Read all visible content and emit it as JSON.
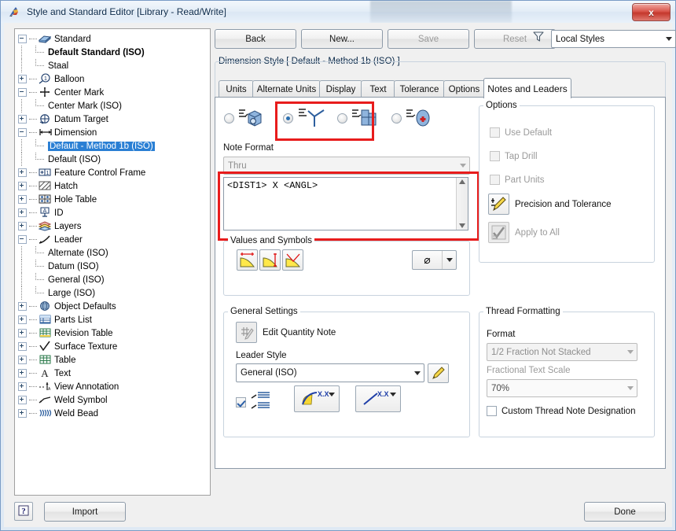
{
  "window": {
    "title": "Style and Standard Editor [Library - Read/Write]",
    "app_icon": "inventor-feather-icon",
    "close_label": "x"
  },
  "colors": {
    "accent": "#2a7fd4",
    "highlight_box": "#e81c1c",
    "title_text": "#0b2a4a",
    "disabled_text": "#9a9a9a"
  },
  "tree": {
    "items": [
      {
        "label": "Standard",
        "level": 0,
        "expander": "minus",
        "icon": "book-icon",
        "style": "normal"
      },
      {
        "label": "Default Standard (ISO)",
        "level": 1,
        "expander": "none",
        "icon": "none",
        "style": "bold"
      },
      {
        "label": "Staal",
        "level": 1,
        "expander": "none",
        "icon": "none",
        "style": "normal"
      },
      {
        "label": "Balloon",
        "level": 0,
        "expander": "plus",
        "icon": "balloon-icon",
        "style": "normal"
      },
      {
        "label": "Center Mark",
        "level": 0,
        "expander": "minus",
        "icon": "center-mark-icon",
        "style": "normal"
      },
      {
        "label": "Center Mark (ISO)",
        "level": 1,
        "expander": "none",
        "icon": "none",
        "style": "normal"
      },
      {
        "label": "Datum Target",
        "level": 0,
        "expander": "plus",
        "icon": "datum-target-icon",
        "style": "normal"
      },
      {
        "label": "Dimension",
        "level": 0,
        "expander": "minus",
        "icon": "dimension-icon",
        "style": "normal"
      },
      {
        "label": "Default - Method 1b (ISO)",
        "level": 1,
        "expander": "none",
        "icon": "none",
        "style": "selected"
      },
      {
        "label": "Default (ISO)",
        "level": 1,
        "expander": "none",
        "icon": "none",
        "style": "normal"
      },
      {
        "label": "Feature Control Frame",
        "level": 0,
        "expander": "plus",
        "icon": "feature-control-frame-icon",
        "style": "normal"
      },
      {
        "label": "Hatch",
        "level": 0,
        "expander": "plus",
        "icon": "hatch-icon",
        "style": "normal"
      },
      {
        "label": "Hole Table",
        "level": 0,
        "expander": "plus",
        "icon": "hole-table-icon",
        "style": "normal"
      },
      {
        "label": "ID",
        "level": 0,
        "expander": "plus",
        "icon": "id-icon",
        "style": "normal"
      },
      {
        "label": "Layers",
        "level": 0,
        "expander": "plus",
        "icon": "layers-icon",
        "style": "normal"
      },
      {
        "label": "Leader",
        "level": 0,
        "expander": "minus",
        "icon": "leader-icon",
        "style": "normal"
      },
      {
        "label": "Alternate (ISO)",
        "level": 1,
        "expander": "none",
        "icon": "none",
        "style": "normal"
      },
      {
        "label": "Datum (ISO)",
        "level": 1,
        "expander": "none",
        "icon": "none",
        "style": "normal"
      },
      {
        "label": "General (ISO)",
        "level": 1,
        "expander": "none",
        "icon": "none",
        "style": "normal"
      },
      {
        "label": "Large (ISO)",
        "level": 1,
        "expander": "none",
        "icon": "none",
        "style": "normal"
      },
      {
        "label": "Object Defaults",
        "level": 0,
        "expander": "plus",
        "icon": "object-defaults-icon",
        "style": "normal"
      },
      {
        "label": "Parts List",
        "level": 0,
        "expander": "plus",
        "icon": "parts-list-icon",
        "style": "normal"
      },
      {
        "label": "Revision Table",
        "level": 0,
        "expander": "plus",
        "icon": "revision-table-icon",
        "style": "normal"
      },
      {
        "label": "Surface Texture",
        "level": 0,
        "expander": "plus",
        "icon": "surface-texture-icon",
        "style": "normal"
      },
      {
        "label": "Table",
        "level": 0,
        "expander": "plus",
        "icon": "table-icon",
        "style": "normal"
      },
      {
        "label": "Text",
        "level": 0,
        "expander": "plus",
        "icon": "text-icon",
        "style": "normal"
      },
      {
        "label": "View Annotation",
        "level": 0,
        "expander": "plus",
        "icon": "view-annotation-icon",
        "style": "normal"
      },
      {
        "label": "Weld Symbol",
        "level": 0,
        "expander": "plus",
        "icon": "weld-symbol-icon",
        "style": "normal"
      },
      {
        "label": "Weld Bead",
        "level": 0,
        "expander": "plus",
        "icon": "weld-bead-icon",
        "style": "normal"
      }
    ]
  },
  "toolbar": {
    "back_label": "Back",
    "new_label": "New...",
    "save_label": "Save",
    "reset_label": "Reset",
    "filter_icon": "funnel-filter-icon",
    "style_scope_value": "Local Styles"
  },
  "style_group": {
    "caption": "Dimension Style [ Default - Method 1b (ISO) ]"
  },
  "tabs": [
    {
      "label": "Units",
      "active": false
    },
    {
      "label": "Alternate Units",
      "active": false
    },
    {
      "label": "Display",
      "active": false
    },
    {
      "label": "Text",
      "active": false
    },
    {
      "label": "Tolerance",
      "active": false
    },
    {
      "label": "Options",
      "active": false
    },
    {
      "label": "Notes and Leaders",
      "active": true
    }
  ],
  "note_type_radios": [
    {
      "icon": "hole-note-3d-icon",
      "selected": false
    },
    {
      "icon": "leader-note-icon",
      "selected": true
    },
    {
      "icon": "chamfer-note-icon",
      "selected": false
    },
    {
      "icon": "punch-note-icon",
      "selected": false
    }
  ],
  "note_format": {
    "label": "Note Format",
    "preset_value": "Thru",
    "text_value": "<DIST1> X <ANGL>",
    "scroll_up_icon": "scroll-up-arrow-icon",
    "scroll_down_icon": "scroll-down-arrow-icon"
  },
  "values_symbols": {
    "caption": "Values and Symbols",
    "buttons": [
      {
        "icon": "chamfer-distance-icon"
      },
      {
        "icon": "chamfer-distance2-icon"
      },
      {
        "icon": "chamfer-angle-icon"
      }
    ],
    "symbol_combo_value": "⌀",
    "symbol_combo_icon": "diameter-symbol-icon"
  },
  "general_settings": {
    "caption": "General Settings",
    "edit_quantity_note_label": "Edit Quantity Note",
    "edit_quantity_note_icon": "quantity-note-pencil-icon",
    "leader_style_label": "Leader Style",
    "leader_style_value": "General (ISO)",
    "edit_style_icon": "pencil-edit-icon",
    "align_checkbox_checked": true,
    "align_icon": "leader-text-align-icon",
    "leader_arc_button_icon": "leader-arc-xx-icon",
    "leader_straight_button_icon": "leader-straight-xx-icon"
  },
  "options": {
    "caption": "Options",
    "use_default_label": "Use Default",
    "use_default_checked": false,
    "use_default_disabled": true,
    "tap_drill_label": "Tap Drill",
    "tap_drill_checked": false,
    "tap_drill_disabled": true,
    "part_units_label": "Part Units",
    "part_units_checked": false,
    "part_units_disabled": true,
    "precision_tolerance_label": "Precision and Tolerance",
    "precision_tolerance_icon": "precision-tolerance-pencil-icon",
    "apply_to_all_label": "Apply to All",
    "apply_to_all_icon": "apply-to-all-check-icon"
  },
  "thread_formatting": {
    "caption": "Thread Formatting",
    "format_label": "Format",
    "format_value": "1/2 Fraction Not Stacked",
    "fractional_text_scale_label": "Fractional Text Scale",
    "fractional_text_scale_value": "70%",
    "custom_thread_label": "Custom Thread Note Designation",
    "custom_thread_checked": false
  },
  "footer": {
    "help_label": "?",
    "help_icon": "help-question-icon",
    "import_label": "Import",
    "done_label": "Done"
  }
}
